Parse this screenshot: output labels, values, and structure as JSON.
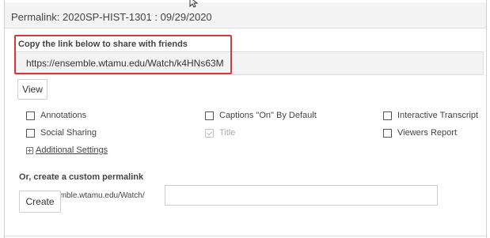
{
  "header": {
    "title": "Permalink: 2020SP-HIST-1301 : 09/29/2020"
  },
  "share": {
    "label": "Copy the link below to share with friends",
    "url": "https://ensemble.wtamu.edu/Watch/k4HNs63M",
    "view_button": "View",
    "highlight_color": "#d9383a"
  },
  "options": {
    "annotations": "Annotations",
    "captions": "Captions \"On\" By Default",
    "interactive_transcript": "Interactive Transcript",
    "social_sharing": "Social Sharing",
    "title": "Title",
    "viewers_report": "Viewers Report",
    "additional_settings": "Additional Settings"
  },
  "custom": {
    "label": "Or, create a custom permalink",
    "base_url": "https://ensemble.wtamu.edu/Watch/",
    "input_value": "",
    "create_button": "Create"
  }
}
